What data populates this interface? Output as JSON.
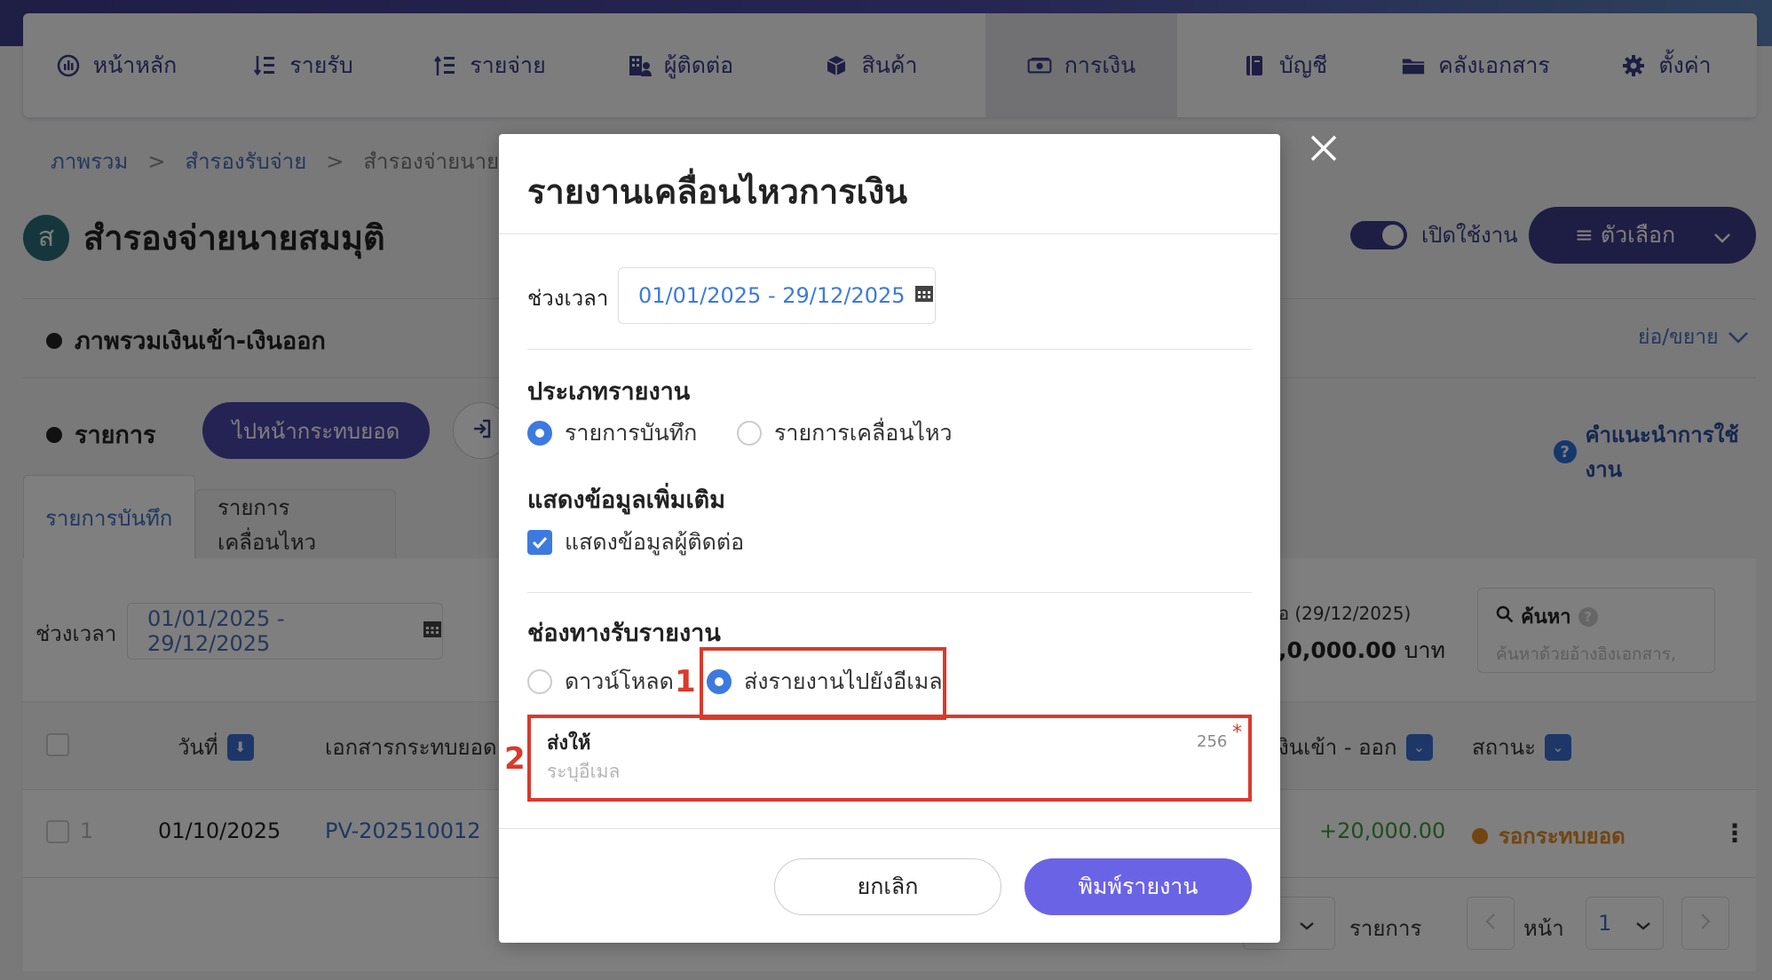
{
  "nav": {
    "items": [
      {
        "label": "หน้าหลัก",
        "icon": "dashboard-icon"
      },
      {
        "label": "รายรับ",
        "icon": "income-list-icon"
      },
      {
        "label": "รายจ่าย",
        "icon": "expense-list-icon"
      },
      {
        "label": "ผู้ติดต่อ",
        "icon": "contacts-building-icon"
      },
      {
        "label": "สินค้า",
        "icon": "product-box-icon"
      },
      {
        "label": "การเงิน",
        "icon": "money-icon"
      },
      {
        "label": "บัญชี",
        "icon": "accounting-book-icon"
      },
      {
        "label": "คลังเอกสาร",
        "icon": "folder-icon"
      },
      {
        "label": "ตั้งค่า",
        "icon": "gear-icon"
      }
    ],
    "active_index": 5
  },
  "breadcrumb": {
    "items": [
      "ภาพรวม",
      "สำรองรับจ่าย",
      "สำรองจ่ายนาย"
    ],
    "separator": ">"
  },
  "page": {
    "avatar_letter": "ส",
    "title": "สำรองจ่ายนายสมมุติ",
    "toggle_label": "เปิดใช้งาน",
    "options_label": "≡ ตัวเลือก"
  },
  "overview": {
    "title": "ภาพรวมเงินเข้า-เงินออก",
    "collapse_label": "ย่อ/ขยาย"
  },
  "list": {
    "title": "รายการ",
    "go_button": "ไปหน้ากระทบยอด",
    "help_label": "คำแนะนำการใช้งาน",
    "tabs": [
      "รายการบันทึก",
      "รายการเคลื่อนไหว"
    ],
    "period_label": "ช่วงเวลา",
    "period_value": "01/01/2025 - 29/12/2025",
    "balance_label": "อ (29/12/2025)",
    "balance_value": ",0,000.00",
    "balance_unit": "บาท",
    "search_label": "ค้นหา",
    "search_placeholder": "ค้นหาด้วยอ้างอิงเอกสาร,",
    "columns": {
      "date": "วันที่",
      "doc": "เอกสารกระทบยอด",
      "inout": "งินเข้า - ออก",
      "status": "สถานะ"
    },
    "rows": [
      {
        "no": "1",
        "date": "01/10/2025",
        "doc": "PV-202510012",
        "amount": "+20,000.00",
        "status": "รอกระทบยอด"
      }
    ],
    "pager": {
      "rows_label": "รายการ",
      "page_label": "หน้า",
      "page_value": "1"
    }
  },
  "modal": {
    "title": "รายงานเคลื่อนไหวการเงิน",
    "period_label": "ช่วงเวลา",
    "period_value": "01/01/2025 - 29/12/2025",
    "report_type_title": "ประเภทรายงาน",
    "report_type_options": [
      "รายการบันทึก",
      "รายการเคลื่อนไหว"
    ],
    "report_type_selected": 0,
    "extra_title": "แสดงข้อมูลเพิ่มเติม",
    "extra_checkbox_label": "แสดงข้อมูลผู้ติดต่อ",
    "extra_checked": true,
    "channel_title": "ช่องทางรับรายงาน",
    "channel_options": [
      "ดาวน์โหลด",
      "ส่งรายงานไปยังอีเมล"
    ],
    "channel_selected": 1,
    "send_to_label": "ส่งให้",
    "send_to_max": "256",
    "send_to_required": "*",
    "send_to_placeholder": "ระบุอีเมล",
    "send_to_value": "",
    "cancel_label": "ยกเลิก",
    "print_label": "พิมพ์รายงาน"
  },
  "annotations": {
    "step1": "1",
    "step2": "2"
  },
  "colors": {
    "brand": "#3d3b86",
    "accent_blue": "#3d7ae0",
    "print_button": "#6b63e6",
    "annotation_red": "#d93a2b",
    "income_green": "#3a9a3a",
    "pending_orange": "#e08a22"
  }
}
